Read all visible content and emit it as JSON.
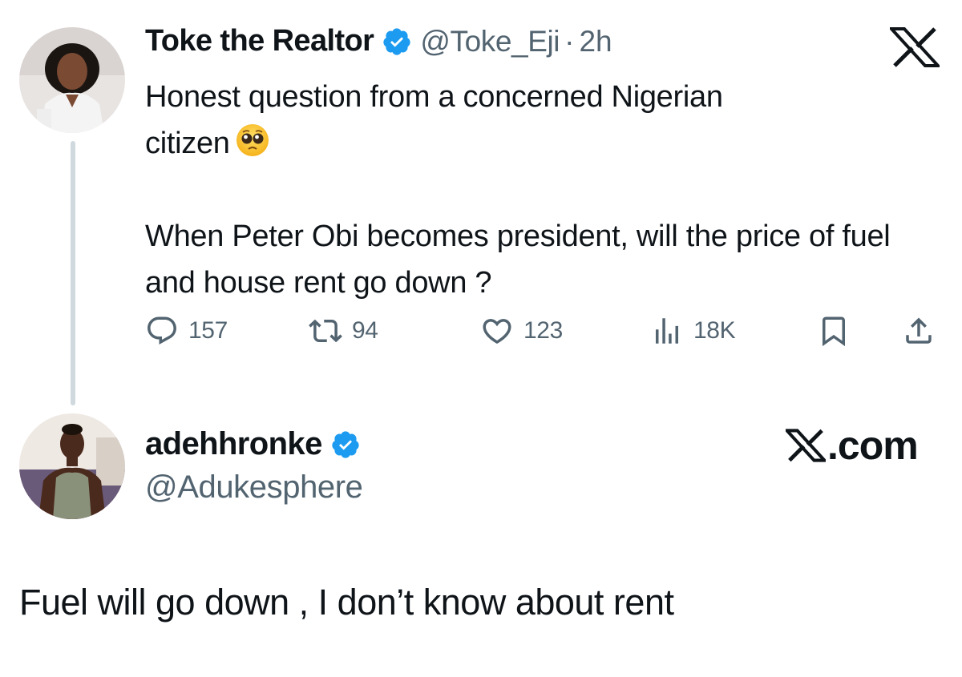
{
  "tweet": {
    "author_name": "Toke the Realtor",
    "author_handle": "@Toke_Eji",
    "separator": "·",
    "time": "2h",
    "text_line1": "Honest question from a concerned Nigerian",
    "text_line2": "citizen",
    "emoji": "pleading-face",
    "text_paragraph2": "When Peter Obi becomes president, will the price of fuel and house rent go down ?",
    "actions": {
      "replies": "157",
      "reposts": "94",
      "likes": "123",
      "views": "18K"
    }
  },
  "reply": {
    "author_name": "adehhronke",
    "author_handle": "@Adukesphere",
    "text": "Fuel will go down , I don’t know about rent"
  },
  "branding": {
    "x_com_text": ".com"
  },
  "colors": {
    "verified_blue": "#1d9bf0",
    "secondary_text": "#536471",
    "thread_line": "#cfd9de"
  }
}
